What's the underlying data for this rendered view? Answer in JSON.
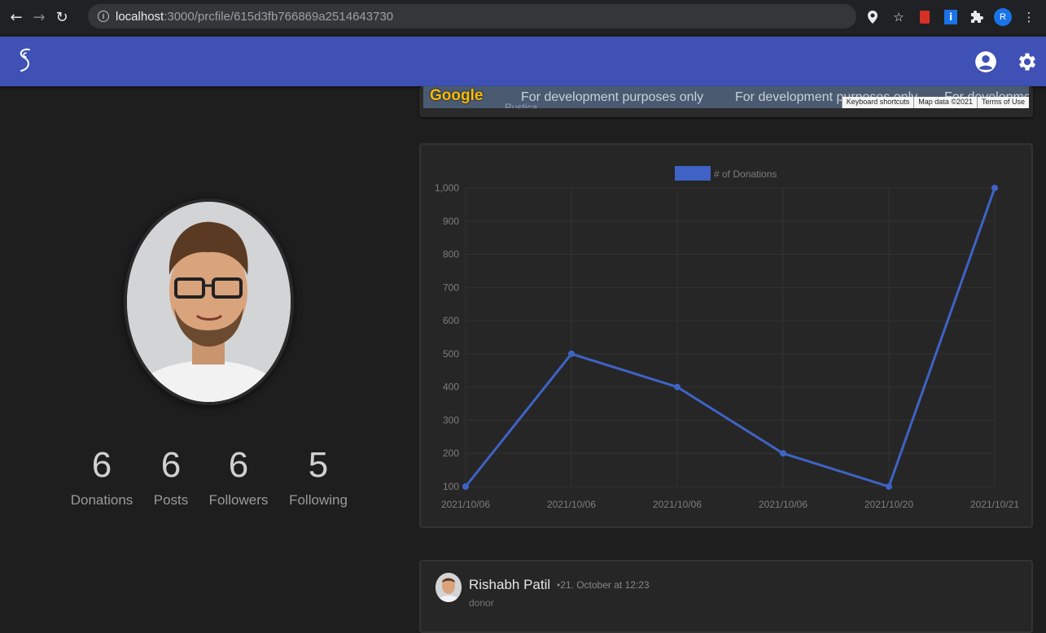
{
  "browser": {
    "url_host": "localhost",
    "url_path": ":3000/prcfile/615d3fb766869a2514643730",
    "profile_initial": "R"
  },
  "map": {
    "dev_notice_1": "For development purposes only",
    "dev_notice_2": "For development purposes only",
    "dev_notice_3": "For developmen",
    "attrib_shortcuts": "Keyboard shortcuts",
    "attrib_data": "Map data ©2021",
    "attrib_terms": "Terms of Use",
    "google_logo": "Google",
    "place_label": "Rustica"
  },
  "profile": {
    "stats": [
      {
        "value": "6",
        "label": "Donations"
      },
      {
        "value": "6",
        "label": "Posts"
      },
      {
        "value": "6",
        "label": "Followers"
      },
      {
        "value": "5",
        "label": "Following"
      }
    ]
  },
  "post": {
    "author": "Rishabh Patil",
    "time": "•21. October at 12:23",
    "role": "donor"
  },
  "colors": {
    "app_bar": "#3f51b5",
    "line": "#3f63c5"
  },
  "chart_data": {
    "type": "line",
    "categories": [
      "2021/10/06",
      "2021/10/06",
      "2021/10/06",
      "2021/10/06",
      "2021/10/20",
      "2021/10/21"
    ],
    "series": [
      {
        "name": "# of Donations",
        "values": [
          100,
          500,
          400,
          200,
          100,
          1000
        ]
      }
    ],
    "yticks": [
      "100",
      "200",
      "300",
      "400",
      "500",
      "600",
      "700",
      "800",
      "900",
      "1,000"
    ],
    "ylim": [
      100,
      1000
    ],
    "grid": true,
    "legend": "top-center"
  }
}
